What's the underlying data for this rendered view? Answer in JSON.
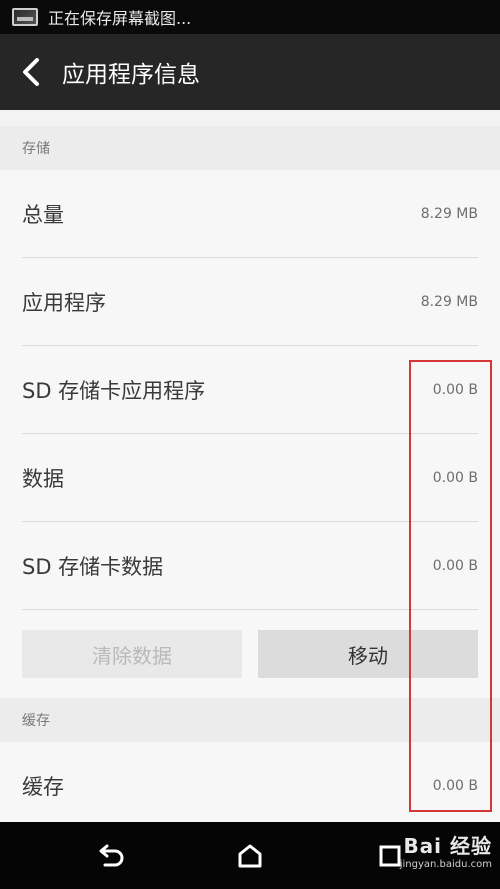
{
  "status_bar": {
    "notification_text": "正在保存屏幕截图..."
  },
  "app_bar": {
    "title": "应用程序信息"
  },
  "storage": {
    "header": "存储",
    "rows": [
      {
        "label": "总量",
        "value": "8.29 MB"
      },
      {
        "label": "应用程序",
        "value": "8.29 MB"
      },
      {
        "label": "SD 存储卡应用程序",
        "value": "0.00 B"
      },
      {
        "label": "数据",
        "value": "0.00 B"
      },
      {
        "label": "SD 存储卡数据",
        "value": "0.00 B"
      }
    ],
    "clear_data_button": "清除数据",
    "move_button": "移动"
  },
  "cache": {
    "header": "缓存",
    "rows": [
      {
        "label": "缓存",
        "value": "0.00 B"
      }
    ]
  },
  "watermark": {
    "brand": "Bai 经验",
    "url": "jingyan.baidu.com"
  },
  "colors": {
    "highlight": "#d63636",
    "app_bar": "#262626",
    "status_bar": "#0a0a0a"
  }
}
